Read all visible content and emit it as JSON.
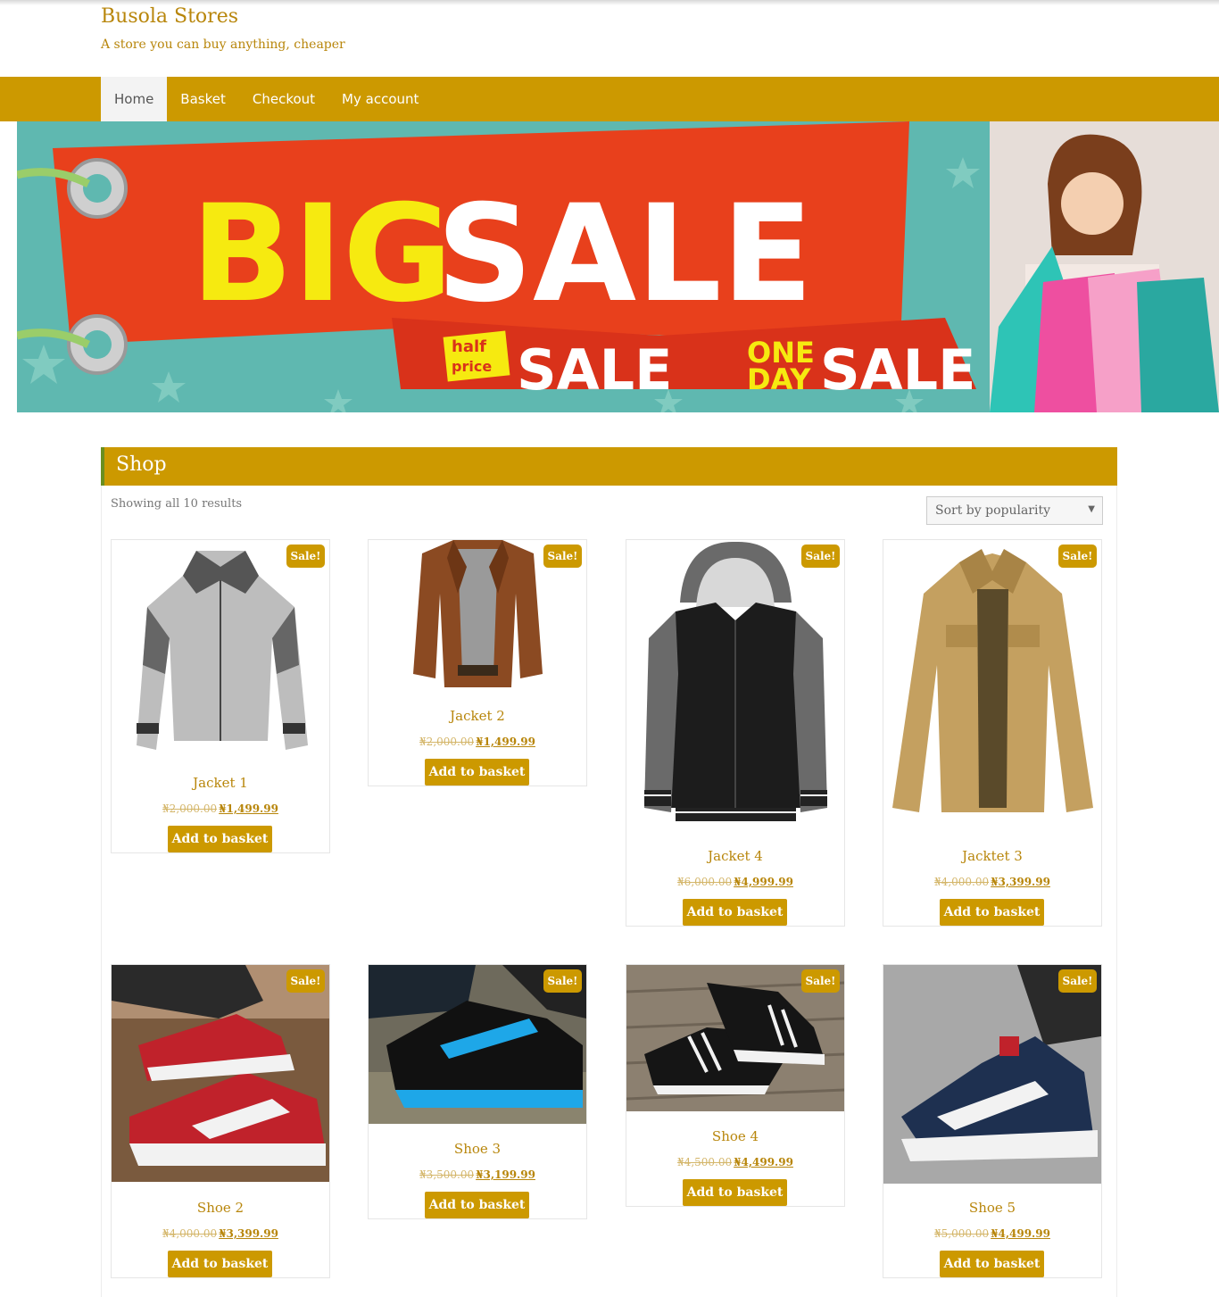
{
  "site": {
    "title": "Busola Stores",
    "tagline": "A store you can buy anything, cheaper"
  },
  "nav": {
    "items": [
      "Home",
      "Basket",
      "Checkout",
      "My account"
    ],
    "active": "Home"
  },
  "banner": {
    "big": "BIG",
    "sale": "SALE",
    "half": "half",
    "price": "price",
    "sale_small": "SALE",
    "one": "ONE",
    "day": "DAY",
    "sale_small_2": "SALE"
  },
  "shop": {
    "title": "Shop",
    "result_count": "Showing all 10 results",
    "sort_selected": "Sort by popularity",
    "sale_badge": "Sale!",
    "add_label": "Add to basket"
  },
  "products": [
    {
      "name": "Jacket 1",
      "old_price": "₦2,000.00",
      "new_price": "₦1,499.99"
    },
    {
      "name": "Jacket 2",
      "old_price": "₦2,000.00",
      "new_price": "₦1,499.99"
    },
    {
      "name": "Jacket 4",
      "old_price": "₦6,000.00",
      "new_price": "₦4,999.99"
    },
    {
      "name": "Jacktet 3",
      "old_price": "₦4,000.00",
      "new_price": "₦3,399.99"
    },
    {
      "name": "Shoe 2",
      "old_price": "₦4,000.00",
      "new_price": "₦3,399.99"
    },
    {
      "name": "Shoe 3",
      "old_price": "₦3,500.00",
      "new_price": "₦3,199.99"
    },
    {
      "name": "Shoe 4",
      "old_price": "₦4,500.00",
      "new_price": "₦4,499.99"
    },
    {
      "name": "Shoe 5",
      "old_price": "₦5,000.00",
      "new_price": "₦4,499.99"
    }
  ],
  "colors": {
    "accent": "#cc9900",
    "title_text": "#b8860b",
    "nav_active_bg": "#f3f3f3"
  }
}
